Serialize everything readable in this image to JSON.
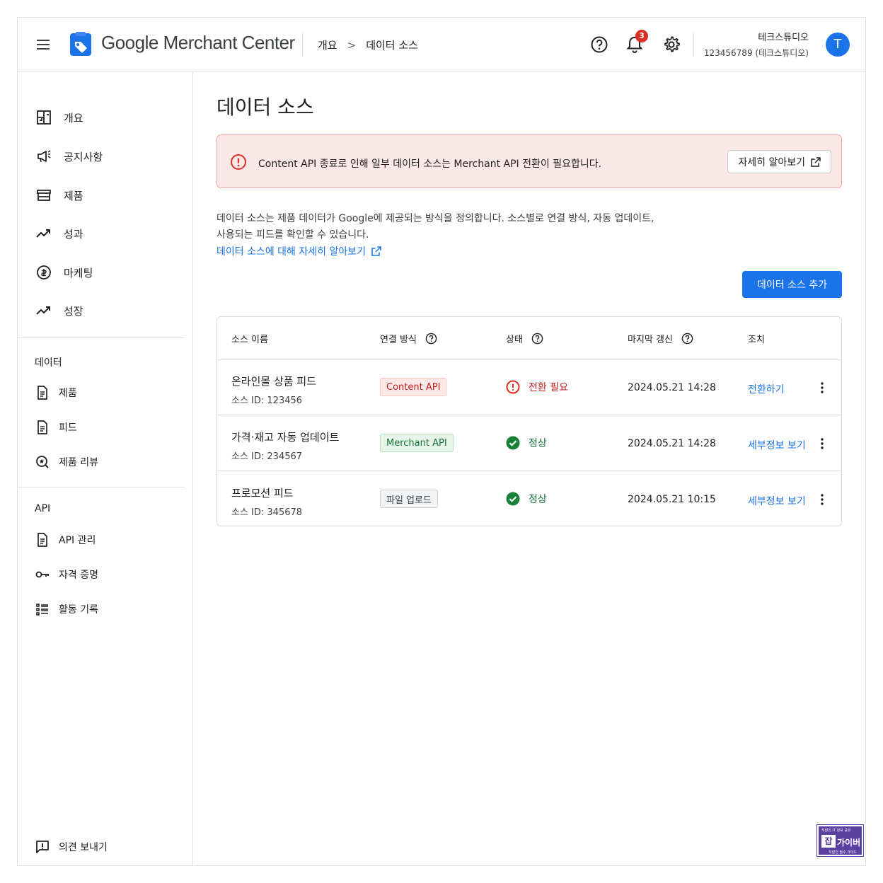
{
  "header": {
    "logo_google": "Google",
    "logo_product": "Merchant Center",
    "breadcrumb": [
      "개요",
      "데이터 소스"
    ],
    "breadcrumb_separator": ">",
    "notification_count": "3",
    "account_name": "테크스튜디오",
    "account_id": "123456789 (테크스튜디오)",
    "avatar_initial": "T"
  },
  "sidebar": {
    "main_items": [
      {
        "label": "개요",
        "icon": "dashboard-icon"
      },
      {
        "label": "공지사항",
        "icon": "megaphone-icon"
      },
      {
        "label": "제품",
        "icon": "store-icon"
      },
      {
        "label": "성과",
        "icon": "trending-up-icon"
      },
      {
        "label": "마케팅",
        "icon": "marketing-icon"
      },
      {
        "label": "성장",
        "icon": "trending-up-icon"
      }
    ],
    "data_section": {
      "title": "데이터",
      "items": [
        {
          "label": "제품",
          "icon": "document-icon"
        },
        {
          "label": "피드",
          "icon": "document-icon"
        },
        {
          "label": "제품 리뷰",
          "icon": "review-icon"
        }
      ]
    },
    "api_section": {
      "title": "API",
      "items": [
        {
          "label": "API 관리",
          "icon": "document-icon"
        },
        {
          "label": "자격 증명",
          "icon": "key-icon"
        },
        {
          "label": "활동 기록",
          "icon": "list-icon"
        }
      ]
    },
    "feedback_label": "의견 보내기"
  },
  "main": {
    "title": "데이터 소스",
    "alert": {
      "text": "Content API 종료로 인해 일부 데이터 소스는 Merchant API 전환이 필요합니다.",
      "button": "자세히 알아보기"
    },
    "description_line1": "데이터 소스는 제품 데이터가 Google에 제공되는 방식을 정의합니다. 소스별로 연결 방식, 자동 업데이트,",
    "description_line2": "사용되는 피드를 확인할 수 있습니다.",
    "learn_more_link": "데이터 소스에 대해 자세히 알아보기",
    "add_button": "데이터 소스 추가",
    "table": {
      "headers": {
        "name": "소스 이름",
        "method": "연결 방식",
        "status": "상태",
        "updated": "마지막 갱신",
        "action": "조치"
      },
      "rows": [
        {
          "name": "온라인몰 상품 피드",
          "source_id": "소스 ID: 123456",
          "method": "Content API",
          "status": "전환 필요",
          "updated": "2024.05.21 14:28",
          "action": "전환하기"
        },
        {
          "name": "가격·재고 자동 업데이트",
          "source_id": "소스 ID: 234567",
          "method": "Merchant API",
          "status": "정상",
          "updated": "2024.05.21 14:28",
          "action": "세부정보 보기"
        },
        {
          "name": "프로모션 피드",
          "source_id": "소스 ID: 345678",
          "method": "파일 업로드",
          "status": "정상",
          "updated": "2024.05.21 10:15",
          "action": "세부정보 보기"
        }
      ]
    }
  },
  "watermark": {
    "top_text": "직장인 IT 정보 공유",
    "badge": "잡",
    "main_text": "가이버",
    "bottom_text": "직장인 필수 가이드"
  },
  "colors": {
    "accent": "#1a73e8",
    "error": "#d93025",
    "success": "#188038",
    "alert_bg": "#fce8e6"
  }
}
